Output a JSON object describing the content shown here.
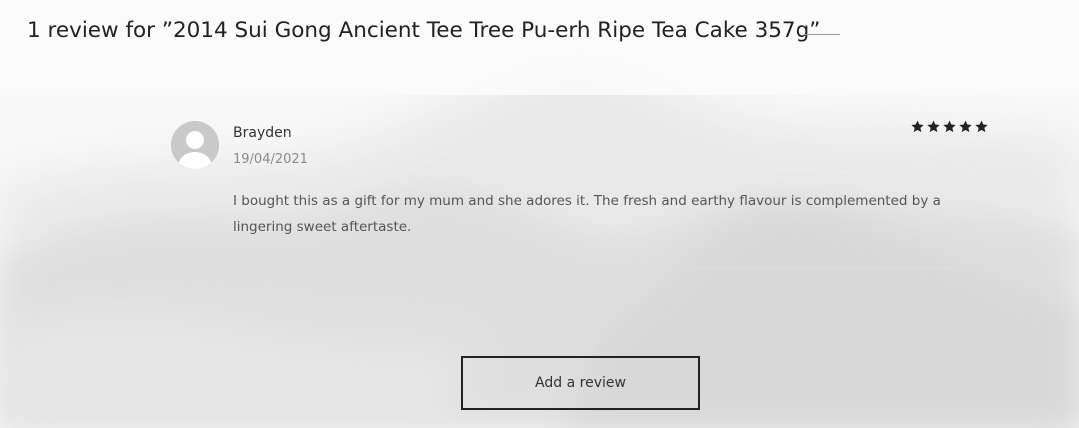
{
  "reviews": {
    "title": "1 review for ”2014 Sui Gong Ancient Tee Tree Pu-erh Ripe Tea Cake 357g”",
    "items": [
      {
        "author": "Brayden",
        "date": "19/04/2021",
        "rating": 5,
        "rating_max": 5,
        "text": "I bought this as a gift for my mum and she adores it. The fresh and earthy flavour is complemented by a lingering sweet aftertaste."
      }
    ],
    "add_review_label": "Add a review"
  },
  "colors": {
    "star": "#222222",
    "button_border": "#222222",
    "avatar": "#c7c7c7",
    "background": "#f7f7f7"
  },
  "icons": {
    "avatar": "user-avatar-icon",
    "star": "star-icon"
  }
}
